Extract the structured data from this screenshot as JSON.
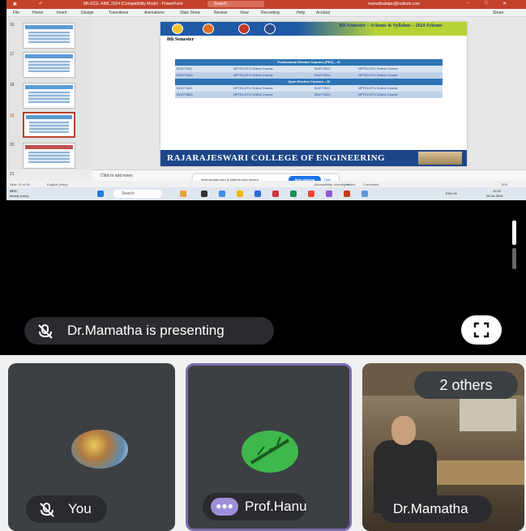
{
  "screen_share": {
    "titlebar": {
      "doc_title": "8th ECE, AIML 2024 (Compatibility Mode) - PowerPoint",
      "search_placeholder": "Search",
      "account": "mamathabapu@outlook.com",
      "share_label": "Share"
    },
    "ribbon_tabs": [
      "File",
      "Home",
      "Insert",
      "Design",
      "Transitions",
      "Animations",
      "Slide Show",
      "Review",
      "View",
      "Recording",
      "Help",
      "Acrobat"
    ],
    "slide_numbers": [
      "16",
      "17",
      "18",
      "19",
      "20",
      "21"
    ],
    "slide": {
      "title": "8th Semester – Scheme & Syllabus – 2024 Scheme",
      "semester": "8th Semester",
      "section1": "Professional Elective Courses (PEC) – IV",
      "section1_rows": [
        [
          "B24YYB11",
          "NPTEL/VTU Online Course",
          "B24YYB12",
          "NPTEL/VTU Online Course"
        ],
        [
          "B24YYB13",
          "NPTEL/VTU Online Course",
          "B24YYB14",
          "NPTEL/VTU Online Course"
        ]
      ],
      "section2": "Open Elective Courses – III",
      "section2_rows": [
        [
          "B24YYB21",
          "NPTEL/VTU Online Course",
          "B24YYB22",
          "NPTEL/VTU Online Course"
        ],
        [
          "B24YYB23",
          "NPTEL/VTU Online Course",
          "B24YYB24",
          "NPTEL/VTU Online Course"
        ]
      ],
      "college": "RAJARAJESWARI COLLEGE OF ENGINEERING"
    },
    "notes_placeholder": "Click to add notes",
    "share_banner": {
      "text": "meet.google.com is sharing your screen.",
      "stop_label": "Stop sharing",
      "hide_label": "Hide"
    },
    "statusbar": {
      "slide_count": "Slide 19 of 28",
      "language": "English (India)",
      "accessibility": "Accessibility: Investigate",
      "notes": "Notes",
      "comments": "Comments",
      "zoom": "76%"
    },
    "taskbar": {
      "weather_temp": "29°C",
      "weather_desc": "Mostly sunny",
      "search_placeholder": "Search",
      "language": "ENG IN",
      "time": "11:26",
      "date": "28-04-2024"
    }
  },
  "meet": {
    "presenting_text": "Dr.Mamatha is presenting",
    "tiles": [
      {
        "name": "You"
      },
      {
        "name": "Prof.Hanu"
      },
      {
        "name": "Dr.Mamatha"
      }
    ],
    "others_label": "2 others"
  }
}
